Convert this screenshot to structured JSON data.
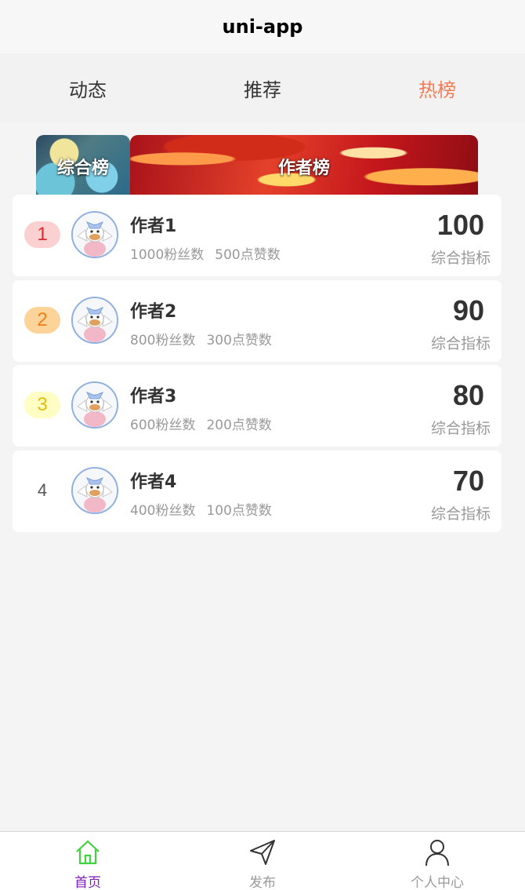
{
  "navbar": {
    "title": "uni-app"
  },
  "tabs": [
    {
      "label": "动态"
    },
    {
      "label": "推荐"
    },
    {
      "label": "热榜"
    }
  ],
  "active_tab": 2,
  "banners": [
    {
      "label": "综合榜"
    },
    {
      "label": "作者榜"
    }
  ],
  "authors": [
    {
      "rank": "1",
      "name": "作者1",
      "fans": "1000粉丝数",
      "likes": "500点赞数",
      "score": "100",
      "score_label": "综合指标"
    },
    {
      "rank": "2",
      "name": "作者2",
      "fans": "800粉丝数",
      "likes": "300点赞数",
      "score": "90",
      "score_label": "综合指标"
    },
    {
      "rank": "3",
      "name": "作者3",
      "fans": "600粉丝数",
      "likes": "200点赞数",
      "score": "80",
      "score_label": "综合指标"
    },
    {
      "rank": "4",
      "name": "作者4",
      "fans": "400粉丝数",
      "likes": "100点赞数",
      "score": "70",
      "score_label": "综合指标"
    }
  ],
  "tabbar": {
    "items": [
      {
        "label": "首页",
        "icon": "home-icon",
        "active": true
      },
      {
        "label": "发布",
        "icon": "send-icon",
        "active": false
      },
      {
        "label": "个人中心",
        "icon": "user-icon",
        "active": false
      }
    ],
    "active_color": "#7a1fb5",
    "active_icon_color": "#3fd33f"
  },
  "colors": {
    "active_tab": "#f57b52",
    "rank1": "#e0282e",
    "rank2": "#ef7d18",
    "rank3": "#e3be08"
  }
}
